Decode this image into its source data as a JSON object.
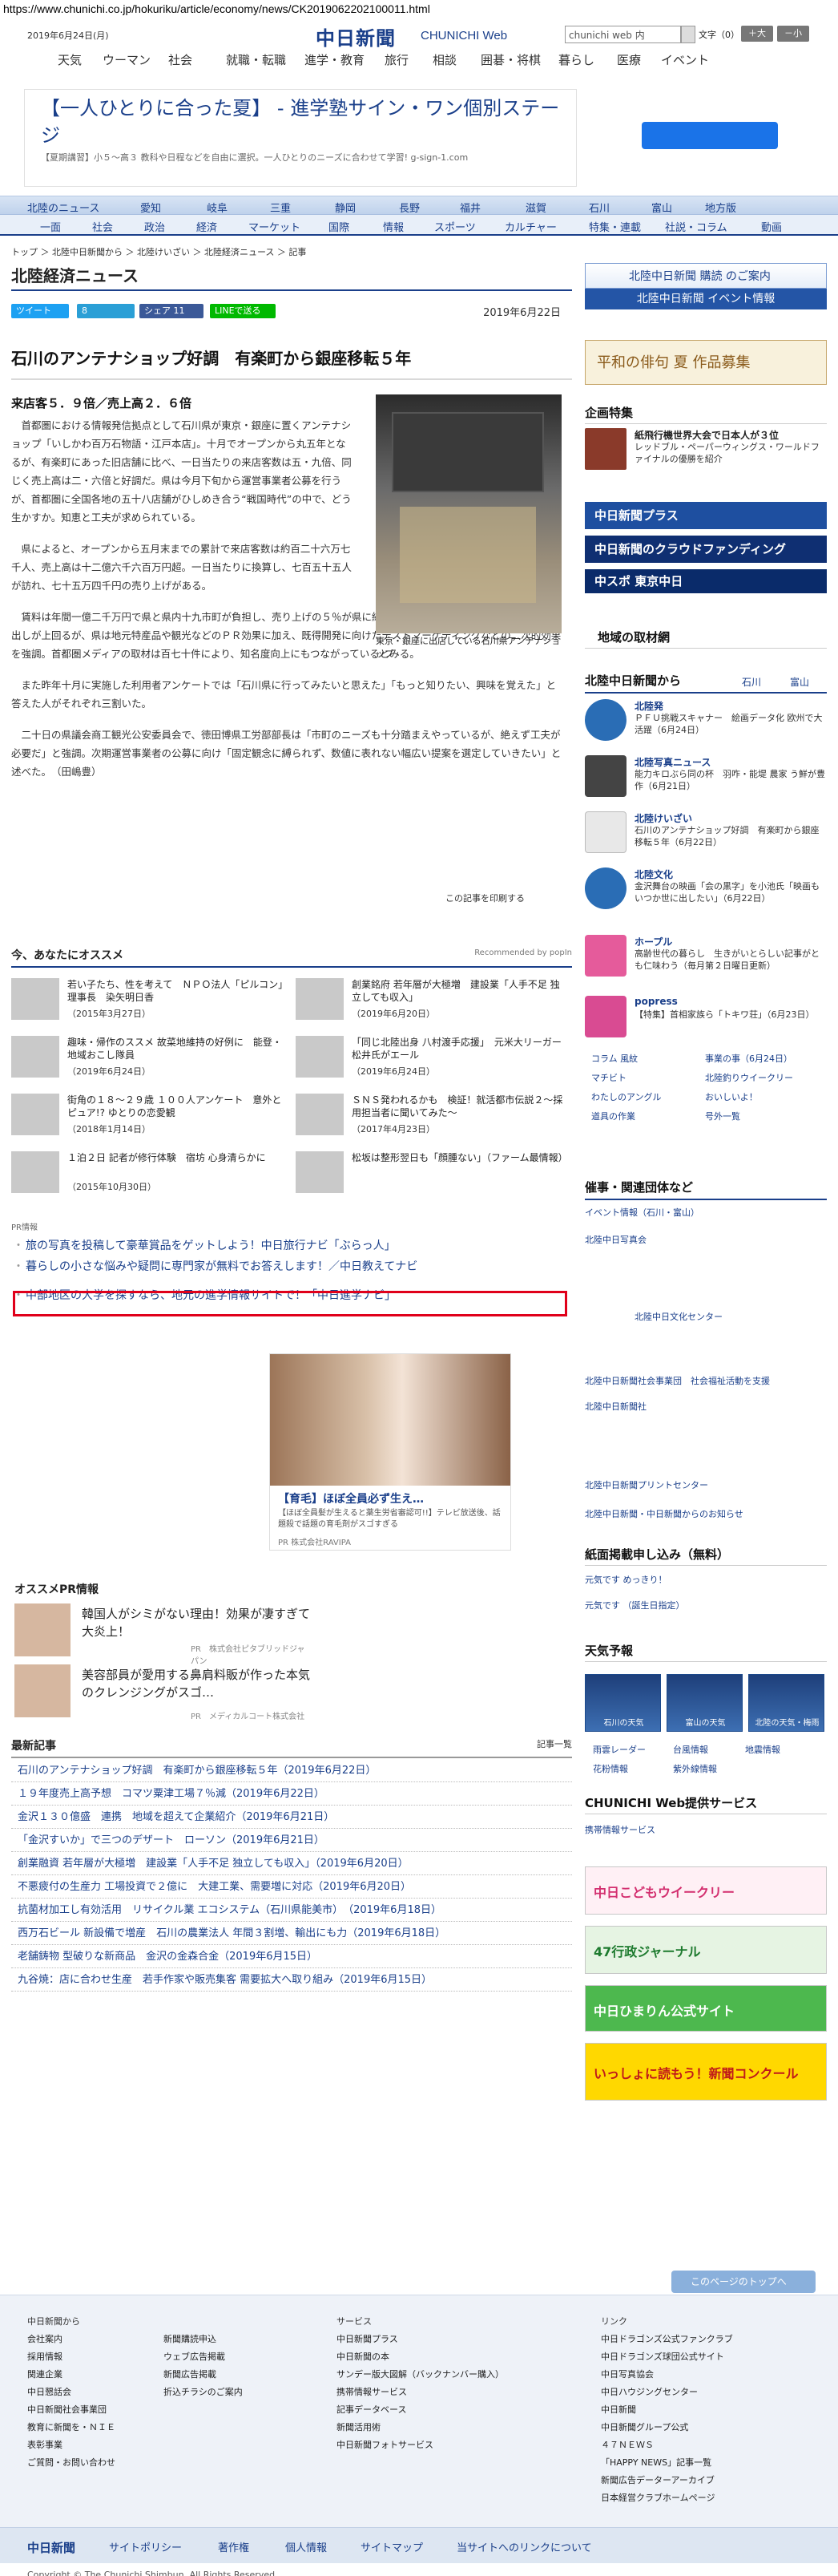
{
  "url": "https://www.chunichi.co.jp/hokuriku/article/economy/news/CK2019062202100011.html",
  "header": {
    "date": "2019年6月24日(月)",
    "logo": "中日新聞",
    "logo_en": "CHUNICHI Web",
    "search_value": "chunichi web 内",
    "font_size": "文字（0）",
    "plus": "＋大",
    "minus": "－小"
  },
  "global_nav": [
    "天気",
    "ウーマン",
    "社会",
    "就職・転職",
    "進学・教育",
    "旅行",
    "相談",
    "囲碁・将棋",
    "暮らし",
    "医療",
    "イベント"
  ],
  "ad": {
    "headline": "【一人ひとりに合った夏】 - 進学塾サイン・ワン個別ステージ",
    "sub": "【夏期講習】小５〜高３ 教科や日程などを自由に選択。一人ひとりのニーズに合わせて学習! g-sign-1.com"
  },
  "nav_regions": [
    "北陸のニュース",
    "愛知",
    "岐阜",
    "三重",
    "静岡",
    "長野",
    "福井",
    "滋賀",
    "石川",
    "富山",
    "地方版"
  ],
  "nav_categories": [
    "一面",
    "社会",
    "政治",
    "経済",
    "マーケット",
    "国際",
    "情報",
    "スポーツ",
    "カルチャー",
    "特集・連載",
    "社説・コラム",
    "動画"
  ],
  "breadcrumb": "トップ ＞ 北陸中日新聞から ＞ 北陸けいざい ＞ 北陸経済ニュース ＞ 記事",
  "section_title": "北陸経済ニュース",
  "shares": [
    "ツイート",
    "8",
    "シェア 11",
    "LINEで送る"
  ],
  "pub_date": "2019年6月22日",
  "article": {
    "title": "石川のアンテナショップ好調　有楽町から銀座移転５年",
    "sub": "来店客５．９倍／売上高２．６倍",
    "p1": "首都圏における情報発信拠点として石川県が東京・銀座に置くアンテナショップ「いしかわ百万石物語・江戸本店」。十月でオープンから丸五年となるが、有楽町にあった旧店舗に比べ、一日当たりの来店客数は五・九倍、同じく売上高は二・六倍と好調だ。県は今月下旬から運営事業者公募を行うが、首都圏に全国各地の五十八店舗がひしめき合う“戦国時代”の中で、どう生かすか。知恵と工夫が求められている。",
    "p2": "県によると、オープンから五月末までの累計で来店客数は約百二十六万七千人、売上高は十二億六千六百万円超。一日当たりに換算し、七百五十五人が訪れ、七十五万四千円の売り上げがある。",
    "p3": "賃料は年間一億二千万円で県と県内十九市町が負担し、売り上げの５％が県に納付される仕組み。悪く思えますよ、持ち出しが上回るが、県は地元特産品や観光などのＰＲ効果に加え、既得開発に向けたテストマーケティングなどの二次的効果を強調。首都圏メディアの取材は百七十件により、知名度向上にもつながっているとみる。",
    "p4": "また昨年十月に実施した利用者アンケートでは「石川県に行ってみたいと思えた」「もっと知りたい、興味を覚えた」と答えた人がそれぞれ三割いた。",
    "p5": "二十日の県議会商工観光公安委員会で、徳田博県工労部部長は「市町のニーズも十分踏まえやっているが、絶えず工夫が必要だ」と強調。次期運営事業者の公募に向け「固定観念に縛られず、数値に表れない幅広い提案を選定していきたい」と述べた。　（田嶋豊）",
    "caption": "東京・銀座に出店している石川県アンテナショップ",
    "print": "この記事を印刷する"
  },
  "recommend": {
    "title": "今、あなたにオススメ",
    "powered": "Recommended by popIn",
    "items": [
      {
        "t": "若い子たち、性を考えて　ＮＰＯ法人「ピルコン」理事長　染矢明日香",
        "d": "（2015年3月27日）"
      },
      {
        "t": "創業銘府 若年層が大極増　建設業「人手不足 独立しても収入」",
        "d": "（2019年6月20日）"
      },
      {
        "t": "趣味・帰作のススメ 故菜地維持の好例に　能登・地域おこし隊員",
        "d": "（2019年6月24日）"
      },
      {
        "t": "「同じ北陸出身 八村渡手応援」　元米大リーガー 松井氏がエール",
        "d": "（2019年6月24日）"
      },
      {
        "t": "街角の１８〜２９歳 １００人アンケート　意外とピュア!? ゆとりの恋愛観",
        "d": "（2018年1月14日）"
      },
      {
        "t": "ＳＮＳ発われるかも　検証！就活都市伝説２〜採用担当者に聞いてみた〜",
        "d": "（2017年4月23日）"
      },
      {
        "t": "１泊２日 記者が修行体験　宿坊 心身清らかに",
        "d": "（2015年10月30日）"
      },
      {
        "t": "松坂は整形翌日も「顔腫ない」（ファーム最情報）",
        "d": ""
      }
    ]
  },
  "pr": {
    "label": "PR情報",
    "links": [
      "旅の写真を投稿して豪華賞品をゲットしよう！中日旅行ナビ「ぶらっ人」",
      "暮らしの小さな悩みや疑問に専門家が無料でお答えします！／中日教えてナビ",
      "中部地区の大学を探すなら、地元の進学情報サイトで！「中日進学ナビ」"
    ]
  },
  "promo": {
    "title": "【育毛】ほぼ全員必ず生え…",
    "desc": "【ほぼ全員髪が生えると薬生労省審認可!!】テレビ放送後、話題殺で話題の育毛剤がスゴすぎる",
    "credit": "PR 株式会社RAVIPA"
  },
  "osusume": {
    "title": "オススメPR情報",
    "items": [
      {
        "t": "韓国人がシミがない理由！効果が凄すぎて大炎上！",
        "c": "PR　株式会社ピタブリッドジャパン"
      },
      {
        "t": "美容部員が愛用する鼻肩料販が作った本気のクレンジングがスゴ…",
        "c": "PR　メディカルコート株式会社"
      }
    ]
  },
  "latest": {
    "title": "最新記事",
    "more": "記事一覧",
    "items": [
      "石川のアンテナショップ好調　有楽町から銀座移転５年（2019年6月22日）",
      "１９年度売上高予想　コマツ粟津工場７％減（2019年6月22日）",
      "金沢１３０億盛　連携　地域を超えて企業紹介（2019年6月21日）",
      "「金沢すいか」で三つのデザート　ローソン（2019年6月21日）",
      "創業融資 若年層が大極増　建設業「人手不足 独立しても収入」（2019年6月20日）",
      "不悪疲付の生産力 工場投資で２億に　大建工業、需要増に対応（2019年6月20日）",
      "抗菌材加工し有効活用　リサイクル業 エコシステム（石川県能美市）　（2019年6月18日）",
      "西万石ビール 新設備で増産　石川の農業法人 年間３割増、輸出にも力（2019年6月18日）",
      "老舗鋳物 型破りな新商品　金沢の金森合金（2019年6月15日）",
      "九谷焼：店に合わせ生産　若手作家や販売集客 需要拡大へ取り組み（2019年6月15日）"
    ]
  },
  "sidebar": {
    "subscribe": "北陸中日新聞 購読 のご案内",
    "event": "北陸中日新聞 イベント情報",
    "haiku": "平和の俳句 夏 作品募集",
    "kikaku": "企画特集",
    "kikaku_item": {
      "t": "紙飛行機世界大会で日本人が３位",
      "s": "レッドブル・ペーパーウィングス・ワールドファイナルの優勝を紹介"
    },
    "plus": "中日新聞プラス",
    "cf": "中日新聞のクラウドファンディング",
    "chunavi": "中スポ 東京中日",
    "local": "地域の取材網",
    "hokuriku": "北陸中日新聞から",
    "hokuriku_tabs": [
      "石川",
      "富山"
    ],
    "items": [
      {
        "t": "北陸発",
        "s": "ＰＦＵ挑戦スキャナー　絵画データ化 欧州で大活躍（6月24日）"
      },
      {
        "t": "北陸写真ニュース",
        "s": "能力キロぶら同の杯　羽咋・能堤 農家 う鮮が豊作（6月21日）"
      },
      {
        "t": "北陸けいざい",
        "s": "石川のアンテナショップ好調　有楽町から銀座移転５年（6月22日）"
      },
      {
        "t": "北陸文化",
        "s": "金沢舞台の映画「会の黒字」を小池氏「映画もいつか世に出したい」（6月22日）"
      },
      {
        "t": "ホープル",
        "s": "高齢世代の暮らし　生きがいとらしい記事がとも仁味わう（毎月第２日曜日更新）"
      },
      {
        "t": "popress",
        "s": "【特集】首相家族ら「トキワ荘」（6月23日）"
      }
    ],
    "small_links": [
      "コラム 風紋",
      "事業の事（6月24日）",
      "マチビト",
      "北陸釣りウイークリー",
      "わたしのアングル",
      "おいしいよ！",
      "道具の作業",
      "号外一覧"
    ],
    "saiji": "催事・関連団体など",
    "saiji_items": [
      "イベント情報（石川・富山）",
      "北陸中日写真会",
      "北陸中日文化センター",
      "北陸中日新聞社会事業団　社会福祉活動を支援",
      "北陸中日新聞社",
      "北陸中日新聞プリントセンター",
      "北陸中日新聞・中日新聞からのお知らせ"
    ],
    "paper": "紙面掲載申し込み（無料）",
    "paper_items": [
      "元気です めっきり！",
      "元気です （誕生日指定）"
    ],
    "weather": "天気予報",
    "weather_items": [
      "石川の天気",
      "富山の天気",
      "北陸の天気・梅雨"
    ],
    "weather_links": [
      "雨雲レーダー",
      "台風情報",
      "地震情報",
      "花粉情報",
      "紫外線情報"
    ],
    "service": "CHUNICHI Web提供サービス",
    "service_items": [
      "携帯情報サービス"
    ],
    "banners": [
      "中日こどもウイークリー",
      "47行政ジャーナル",
      "中日ひまりん公式サイト",
      "いっしょに読もう！新聞コンクール"
    ]
  },
  "totop": "このページのトップへ",
  "footer": {
    "col1": [
      "中日新聞から",
      "会社案内",
      "採用情報",
      "関連企業",
      "中日懇話会",
      "中日新聞社会事業団",
      "教育に新聞を・ＮＩＥ",
      "表彰事業",
      "ご質問・お問い合わせ"
    ],
    "col2": [
      "",
      "新聞購読申込",
      "ウェブ広告掲載",
      "新聞広告掲載",
      "折込チラシのご案内"
    ],
    "col3": [
      "サービス",
      "中日新聞プラス",
      "中日新聞の本",
      "サンデー版大図解（バックナンバー購入）",
      "携帯情報サービス",
      "記事データベース",
      "新聞活用術",
      "中日新聞フォトサービス"
    ],
    "col4": [
      "リンク",
      "中日ドラゴンズ公式ファンクラブ",
      "中日ドラゴンズ球団公式サイト",
      "中日写真協会",
      "中日ハウジングセンター",
      "中日新聞",
      "中日新聞グループ公式",
      "４７ＮＥＷＳ",
      "「HAPPY NEWS」記事一覧",
      "新聞広告データーアーカイブ",
      "日本経営クラブホームページ"
    ],
    "bar": [
      "中日新聞",
      "サイトポリシー",
      "著作権",
      "個人情報",
      "サイトマップ",
      "当サイトへのリンクについて"
    ],
    "copyright": "Copyright © The Chunichi Shimbun, All Rights Reserved."
  }
}
